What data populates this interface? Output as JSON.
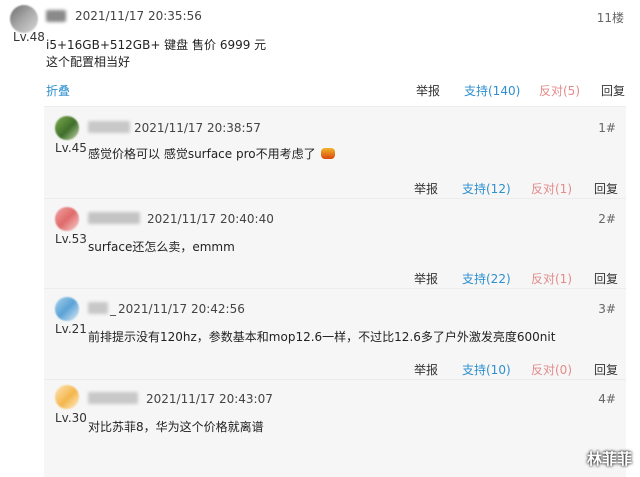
{
  "main_post": {
    "level": "Lv.48",
    "time": "2021/11/17 20:35:56",
    "floor": "11楼",
    "content_line1": "i5+16GB+512GB+ 键盘 售价 6999 元",
    "content_line2": "这个配置相当好",
    "collapse": "折叠",
    "actions": {
      "report": "举报",
      "support": "支持(140)",
      "oppose": "反对(5)",
      "reply": "回复"
    }
  },
  "replies": [
    {
      "level": "Lv.45",
      "time": "2021/11/17 20:38:57",
      "floor": "1#",
      "content": "感觉价格可以 感觉surface pro不用考虑了",
      "actions": {
        "report": "举报",
        "support": "支持(12)",
        "oppose": "反对(1)",
        "reply": "回复"
      }
    },
    {
      "level": "Lv.53",
      "time": "2021/11/17 20:40:40",
      "floor": "2#",
      "content": "surface还怎么卖，emmm",
      "actions": {
        "report": "举报",
        "support": "支持(22)",
        "oppose": "反对(1)",
        "reply": "回复"
      }
    },
    {
      "level": "Lv.21",
      "name_suffix": "_",
      "time": "2021/11/17 20:42:56",
      "floor": "3#",
      "content": "前排提示没有120hz，参数基本和mop12.6一样，不过比12.6多了户外激发亮度600nit",
      "actions": {
        "report": "举报",
        "support": "支持(10)",
        "oppose": "反对(0)",
        "reply": "回复"
      }
    },
    {
      "level": "Lv.30",
      "time": "2021/11/17 20:43:07",
      "floor": "4#",
      "content": "对比苏菲8，华为这个价格就离谱"
    }
  ],
  "watermark": "林菲菲",
  "colors": {
    "support": "#2f8fcf",
    "oppose": "#e38b8b",
    "reply_bg": "#f6f6f6"
  }
}
